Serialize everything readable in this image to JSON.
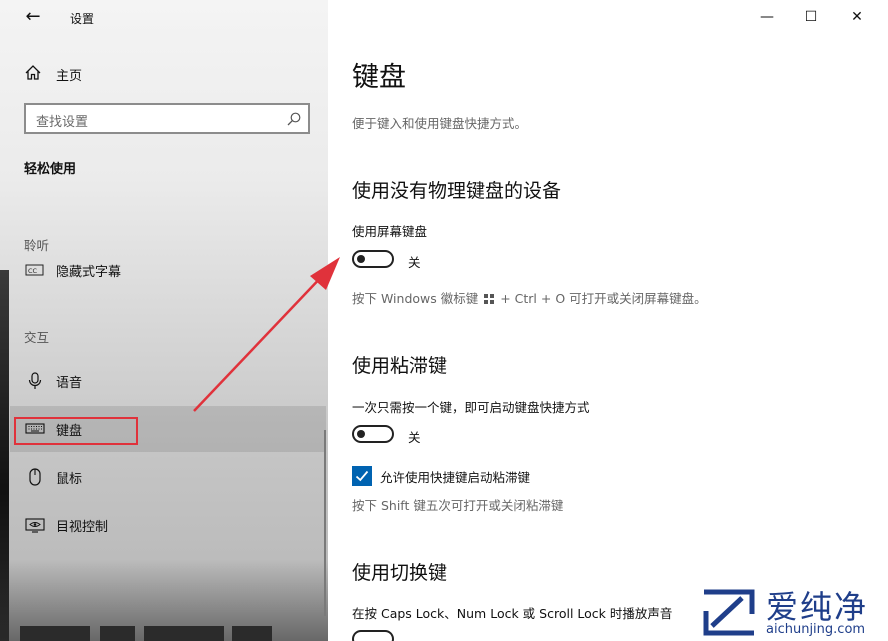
{
  "window": {
    "title": "设置",
    "back_icon": "back-arrow-icon",
    "controls": {
      "minimize": "—",
      "maximize": "☐",
      "close": "✕"
    }
  },
  "sidebar": {
    "home_label": "主页",
    "search_placeholder": "查找设置",
    "section_title": "轻松使用",
    "groups": [
      {
        "label": "聆听",
        "items": [
          {
            "label": "隐藏式字幕",
            "icon": "closed-caption-icon"
          }
        ]
      },
      {
        "label": "交互",
        "items": [
          {
            "label": "语音",
            "icon": "microphone-icon"
          },
          {
            "label": "键盘",
            "icon": "keyboard-icon",
            "selected": true
          },
          {
            "label": "鼠标",
            "icon": "mouse-icon"
          },
          {
            "label": "目视控制",
            "icon": "eye-control-icon"
          }
        ]
      }
    ]
  },
  "main": {
    "title": "键盘",
    "description": "便于键入和使用键盘快捷方式。",
    "sections": [
      {
        "heading": "使用没有物理键盘的设备",
        "setting_label": "使用屏幕键盘",
        "toggle_state": "关",
        "hint_prefix": "按下 Windows 徽标键",
        "hint_suffix": "+ Ctrl + O 可打开或关闭屏幕键盘。"
      },
      {
        "heading": "使用粘滞键",
        "setting_label": "一次只需按一个键，即可启动键盘快捷方式",
        "toggle_state": "关",
        "checkbox_label": "允许使用快捷键启动粘滞键",
        "checkbox_checked": true,
        "hint": "按下 Shift 键五次可打开或关闭粘滞键"
      },
      {
        "heading": "使用切换键",
        "setting_label": "在按 Caps Lock、Num Lock 或 Scroll Lock 时播放声音"
      }
    ]
  },
  "watermark": {
    "brand": "爱纯净",
    "url": "aichunjing.com"
  },
  "colors": {
    "accent": "#0063b1",
    "annotation": "#e0323b",
    "watermark": "#1f3e8a"
  }
}
